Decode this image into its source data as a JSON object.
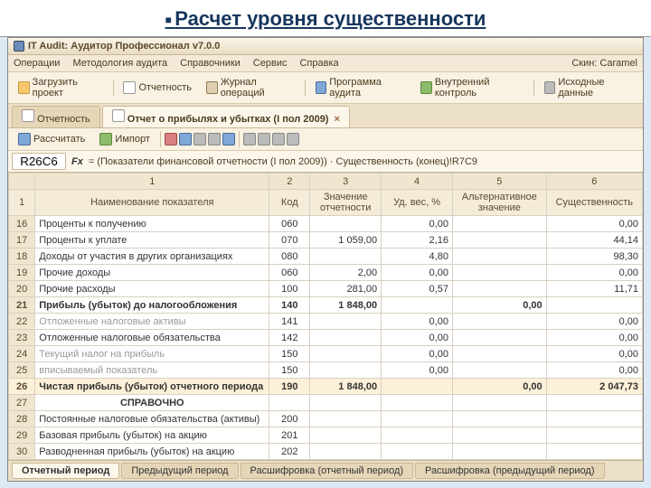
{
  "slide_title": "Расчет уровня существенности",
  "window_title": "IT Audit: Аудитор Профессионал v7.0.0",
  "menu": {
    "items": [
      "Операции",
      "Методология аудита",
      "Справочники",
      "Сервис",
      "Справка"
    ],
    "skin_label": "Скин:",
    "skin_value": "Caramel"
  },
  "toolbar1": {
    "load": "Загрузить проект",
    "reporting": "Отчетность",
    "journal": "Журнал операций",
    "program": "Программа аудита",
    "internal": "Внутренний контроль",
    "source": "Исходные данные"
  },
  "tabs": {
    "t1": "Отчетность",
    "t2": "Отчет о прибылях и убытках (I пол 2009)"
  },
  "toolbar2": {
    "calc": "Рассчитать",
    "import": "Импорт"
  },
  "formula": {
    "cell": "R26C6",
    "fx": "Fx",
    "text": "= (Показатели финансовой отчетности (I пол 2009)) · Существенность (конец)!R7C9"
  },
  "columns": {
    "c1": "1",
    "c2": "2",
    "c3": "3",
    "c4": "4",
    "c5": "5",
    "c6": "6",
    "h1": "Наименование показателя",
    "h2": "Код",
    "h3": "Значение отчетности",
    "h4": "Уд. вес, %",
    "h5": "Альтернативное значение",
    "h6": "Существенность"
  },
  "rows": [
    {
      "n": "16",
      "name": "Проценты к получению",
      "code": "060",
      "val": "",
      "wt": "0,00",
      "alt": "",
      "ess": "0,00"
    },
    {
      "n": "17",
      "name": "Проценты к уплате",
      "code": "070",
      "val": "1 059,00",
      "wt": "2,16",
      "alt": "",
      "ess": "44,14"
    },
    {
      "n": "18",
      "name": "Доходы от участия в других организациях",
      "code": "080",
      "val": "",
      "wt": "4,80",
      "alt": "",
      "ess": "98,30"
    },
    {
      "n": "19",
      "name": "Прочие доходы",
      "code": "060",
      "val": "2,00",
      "wt": "0,00",
      "alt": "",
      "ess": "0,00"
    },
    {
      "n": "20",
      "name": "Прочие расходы",
      "code": "100",
      "val": "281,00",
      "wt": "0,57",
      "alt": "",
      "ess": "11,71"
    },
    {
      "n": "21",
      "name": "Прибыль (убыток) до налогообложения",
      "code": "140",
      "val": "1 848,00",
      "wt": "",
      "alt": "0,00",
      "ess": "",
      "bold": true
    },
    {
      "n": "22",
      "name": "Отложенные налоговые активы",
      "code": "141",
      "val": "",
      "wt": "0,00",
      "alt": "",
      "ess": "0,00",
      "dim": true
    },
    {
      "n": "23",
      "name": "Отложенные налоговые обязательства",
      "code": "142",
      "val": "",
      "wt": "0,00",
      "alt": "",
      "ess": "0,00"
    },
    {
      "n": "24",
      "name": "Текущий налог на прибыль",
      "code": "150",
      "val": "",
      "wt": "0,00",
      "alt": "",
      "ess": "0,00",
      "dim": true
    },
    {
      "n": "25",
      "name": "вписываемый показатель",
      "code": "150",
      "val": "",
      "wt": "0,00",
      "alt": "",
      "ess": "0,00",
      "dim": true
    },
    {
      "n": "26",
      "name": "Чистая прибыль (убыток) отчетного периода",
      "code": "190",
      "val": "1 848,00",
      "wt": "",
      "alt": "0,00",
      "ess": "2 047,73",
      "bold": true,
      "hl": true
    },
    {
      "n": "27",
      "name": "СПРАВОЧНО",
      "code": "",
      "val": "",
      "wt": "",
      "alt": "",
      "ess": "",
      "section": true
    },
    {
      "n": "28",
      "name": "Постоянные налоговые обязательства (активы)",
      "code": "200",
      "val": "",
      "wt": "",
      "alt": "",
      "ess": ""
    },
    {
      "n": "29",
      "name": "Базовая прибыль (убыток) на акцию",
      "code": "201",
      "val": "",
      "wt": "",
      "alt": "",
      "ess": ""
    },
    {
      "n": "30",
      "name": "Разводненная прибыль (убыток) на акцию",
      "code": "202",
      "val": "",
      "wt": "",
      "alt": "",
      "ess": ""
    }
  ],
  "bottom_tabs": {
    "t1": "Отчетный период",
    "t2": "Предыдущий период",
    "t3": "Расшифровка (отчетный период)",
    "t4": "Расшифровка (предыдущий период)"
  }
}
